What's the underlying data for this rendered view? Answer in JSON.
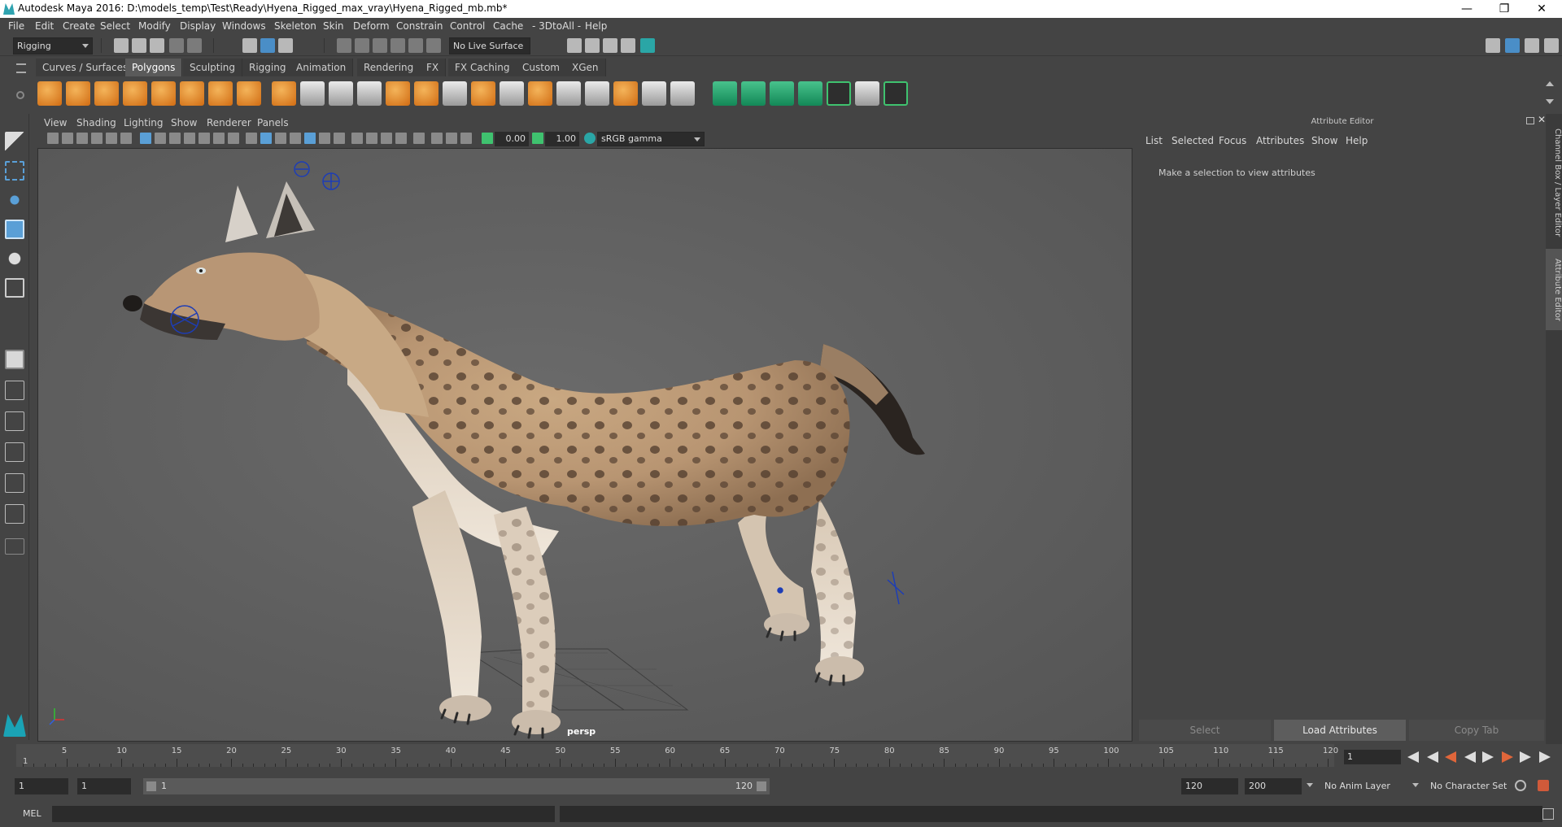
{
  "window": {
    "title": "Autodesk Maya 2016: D:\\models_temp\\Test\\Ready\\Hyena_Rigged_max_vray\\Hyena_Rigged_mb.mb*",
    "minimize": "—",
    "restore": "❐",
    "close": "✕"
  },
  "menubar": [
    "File",
    "Edit",
    "Create",
    "Select",
    "Modify",
    "Display",
    "Windows",
    "Skeleton",
    "Skin",
    "Deform",
    "Constrain",
    "Control",
    "Cache",
    "- 3DtoAll -",
    "Help"
  ],
  "statusline": {
    "mode": "Rigging",
    "live_surface": "No Live Surface"
  },
  "shelf_tabs": [
    "Curves / Surfaces",
    "Polygons",
    "Sculpting",
    "Rigging",
    "Animation",
    "Rendering",
    "FX",
    "FX Caching",
    "Custom",
    "XGen"
  ],
  "shelf_active": "Polygons",
  "viewport": {
    "menu": [
      "View",
      "Shading",
      "Lighting",
      "Show",
      "Renderer",
      "Panels"
    ],
    "exposure": "0.00",
    "gamma": "1.00",
    "color_space": "sRGB gamma",
    "camera_label": "persp"
  },
  "attribute_editor": {
    "title": "Attribute Editor",
    "menu": [
      "List",
      "Selected",
      "Focus",
      "Attributes",
      "Show",
      "Help"
    ],
    "message": "Make a selection to view attributes",
    "buttons": [
      "Select",
      "Load Attributes",
      "Copy Tab"
    ]
  },
  "side_tabs": [
    "Channel Box / Layer Editor",
    "Attribute Editor"
  ],
  "timeline": {
    "ticks": [
      "5",
      "10",
      "15",
      "20",
      "25",
      "30",
      "35",
      "40",
      "45",
      "50",
      "55",
      "60",
      "65",
      "70",
      "75",
      "80",
      "85",
      "90",
      "95",
      "100",
      "105",
      "110",
      "115",
      "120"
    ],
    "start_label": "1",
    "current_frame": "1"
  },
  "range": {
    "start": "1",
    "inner_start": "1",
    "slider_start": "1",
    "slider_end": "120",
    "end": "120",
    "max": "200",
    "anim_layer": "No Anim Layer",
    "character_set": "No Character Set"
  },
  "command_line": {
    "label": "MEL"
  },
  "colors": {
    "accent": "#5a9fd6",
    "shelf_green": "#3fc26f",
    "background": "#444444"
  }
}
